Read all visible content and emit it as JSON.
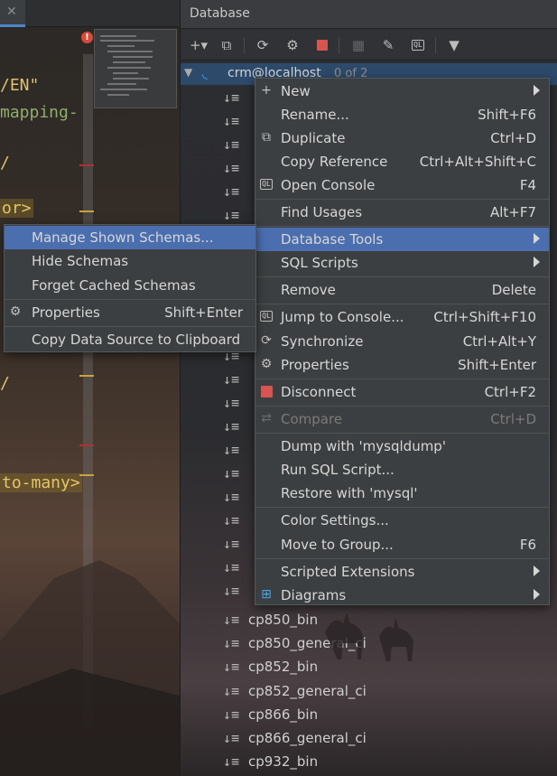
{
  "editor": {
    "tab_close": "✕",
    "error_glyph": "!",
    "code_lines": [
      "/EN\"",
      "mapping-",
      "or>",
      "to-many>"
    ]
  },
  "db_panel": {
    "title": "Database",
    "toolbar_icons": [
      "add-icon",
      "duplicate-icon",
      "refresh-icon",
      "properties-icon",
      "stop-icon",
      "table-icon",
      "edit-icon",
      "console-icon",
      "filter-icon"
    ],
    "root": {
      "name": "crm@localhost",
      "count": "0 of 2"
    },
    "tree_items": [
      "cp850_bin",
      "cp850_general_ci",
      "cp852_bin",
      "cp852_general_ci",
      "cp866_bin",
      "cp866_general_ci",
      "cp932_bin"
    ],
    "sort_icon": "↓≡"
  },
  "main_menu": {
    "items": [
      {
        "label": "New",
        "shortcut": "",
        "icon": "+",
        "submenu": true
      },
      {
        "label": "Rename...",
        "shortcut": "Shift+F6",
        "icon": "",
        "submenu": false
      },
      {
        "label": "Duplicate",
        "shortcut": "Ctrl+D",
        "icon": "⧉",
        "submenu": false
      },
      {
        "label": "Copy Reference",
        "shortcut": "Ctrl+Alt+Shift+C",
        "icon": "",
        "submenu": false
      },
      {
        "label": "Open Console",
        "shortcut": "F4",
        "icon": "QL",
        "submenu": false
      },
      {
        "label": "Find Usages",
        "shortcut": "Alt+F7",
        "icon": "",
        "submenu": false
      },
      {
        "label": "Database Tools",
        "shortcut": "",
        "icon": "",
        "submenu": true
      },
      {
        "label": "SQL Scripts",
        "shortcut": "",
        "icon": "",
        "submenu": true
      },
      {
        "label": "Remove",
        "shortcut": "Delete",
        "icon": "",
        "submenu": false
      },
      {
        "label": "Jump to Console...",
        "shortcut": "Ctrl+Shift+F10",
        "icon": "QL",
        "submenu": false
      },
      {
        "label": "Synchronize",
        "shortcut": "Ctrl+Alt+Y",
        "icon": "⟳",
        "submenu": false
      },
      {
        "label": "Properties",
        "shortcut": "Shift+Enter",
        "icon": "⚙",
        "submenu": false
      },
      {
        "label": "Disconnect",
        "shortcut": "Ctrl+F2",
        "icon": "■",
        "submenu": false
      },
      {
        "label": "Compare",
        "shortcut": "Ctrl+D",
        "icon": "⇄",
        "submenu": false
      },
      {
        "label": "Dump with 'mysqldump'",
        "shortcut": "",
        "icon": "",
        "submenu": false
      },
      {
        "label": "Run SQL Script...",
        "shortcut": "",
        "icon": "",
        "submenu": false
      },
      {
        "label": "Restore with 'mysql'",
        "shortcut": "",
        "icon": "",
        "submenu": false
      },
      {
        "label": "Color Settings...",
        "shortcut": "",
        "icon": "",
        "submenu": false
      },
      {
        "label": "Move to Group...",
        "shortcut": "F6",
        "icon": "",
        "submenu": false
      },
      {
        "label": "Scripted Extensions",
        "shortcut": "",
        "icon": "",
        "submenu": true
      },
      {
        "label": "Diagrams",
        "shortcut": "",
        "icon": "⊞",
        "submenu": true
      }
    ]
  },
  "sub_menu": {
    "items": [
      {
        "label": "Manage Shown Schemas...",
        "shortcut": ""
      },
      {
        "label": "Hide Schemas",
        "shortcut": ""
      },
      {
        "label": "Forget Cached Schemas",
        "shortcut": ""
      },
      {
        "label": "Properties",
        "shortcut": "Shift+Enter"
      },
      {
        "label": "Copy Data Source to Clipboard",
        "shortcut": ""
      }
    ]
  },
  "colors": {
    "selection": "#4b6eaf",
    "menu_bg": "#3c3f41",
    "disconnect_red": "#d9534f",
    "accent_blue": "#4aa3e8"
  }
}
